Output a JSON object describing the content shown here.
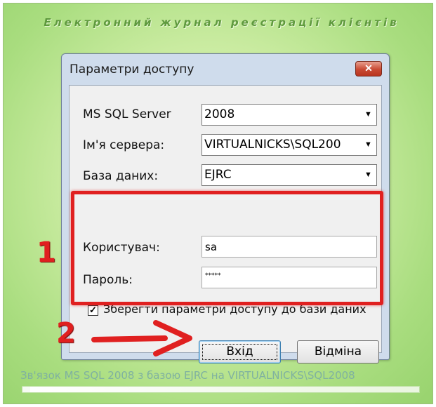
{
  "app": {
    "title": "Електронний журнал реєстрації клієнтів",
    "status_text": "Зв'язок MS SQL 2008 з базою EJRC на VIRTUALNICKS\\SQL2008",
    "progress_fraction": 0.02
  },
  "dialog": {
    "title": "Параметри доступу",
    "close_glyph": "✕",
    "server_type": {
      "label": "MS SQL Server",
      "value": "2008"
    },
    "server_name": {
      "label": "Ім'я сервера:",
      "value": "VIRTUALNICKS\\SQL200"
    },
    "database": {
      "label": "База даних:",
      "value": "EJRC"
    },
    "user": {
      "label": "Користувач:",
      "value": "sa"
    },
    "password": {
      "label": "Пароль:",
      "value": "*****"
    },
    "save_params": {
      "label": "Зберегти параметри доступу до бази даних",
      "checked": true,
      "check_glyph": "✓"
    },
    "buttons": {
      "login": "Вхід",
      "cancel": "Відміна"
    },
    "dropdown_glyph": "▼"
  },
  "annotations": {
    "marker_1": "1",
    "marker_2": "2",
    "highlight_color": "#e02020"
  }
}
